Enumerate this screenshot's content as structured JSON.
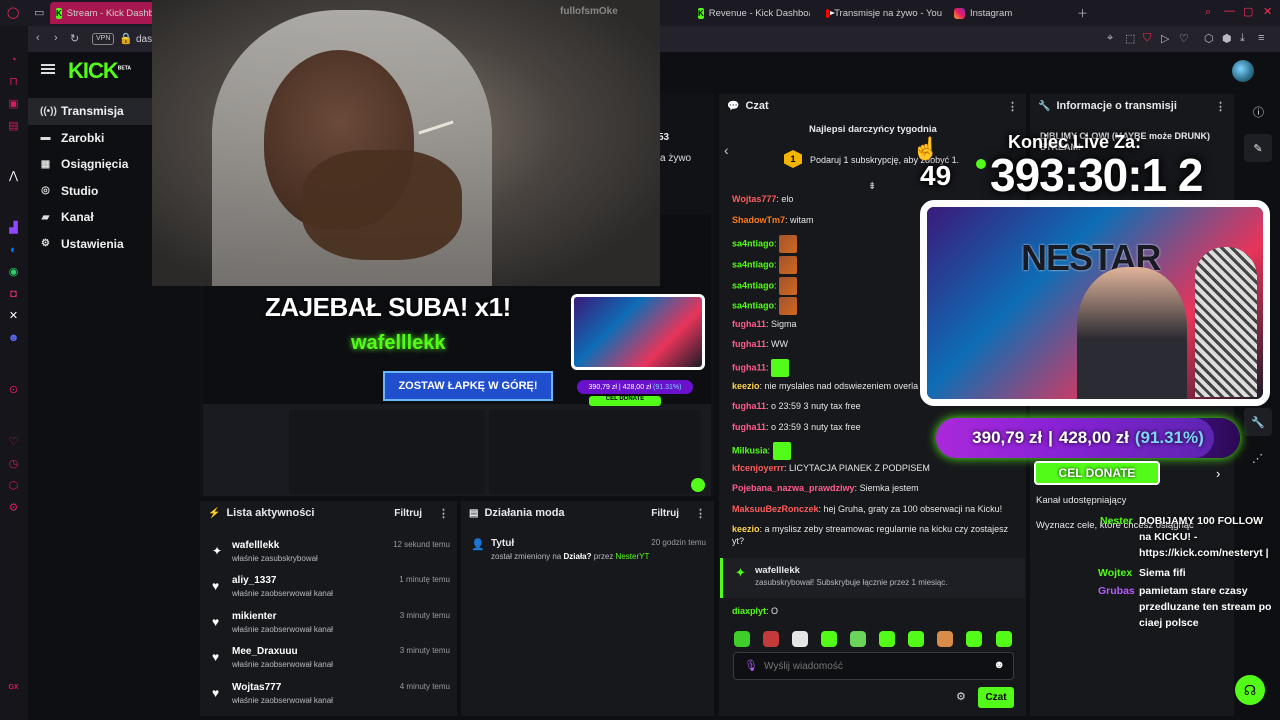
{
  "browser": {
    "tabs": [
      {
        "label": "Stream - Kick Dashbo",
        "icon": "kick-favicon",
        "active": true
      },
      {
        "label": "Revenue - Kick Dashboa",
        "icon": "kick-favicon"
      },
      {
        "label": "Transmisje na żywo - You",
        "icon": "youtube-favicon"
      },
      {
        "label": "Instagram",
        "icon": "instagram-favicon"
      }
    ],
    "address": "dash",
    "vpn_label": "VPN",
    "gx_label": "GX"
  },
  "app": {
    "logo": "KICK",
    "logo_badge": "BETA",
    "nav": [
      {
        "label": "Transmisja",
        "icon": "broadcast-icon",
        "active": true
      },
      {
        "label": "Zarobki",
        "icon": "wallet-icon"
      },
      {
        "label": "Osiągnięcia",
        "icon": "trophy-icon"
      },
      {
        "label": "Studio",
        "icon": "studio-icon"
      },
      {
        "label": "Kanał",
        "icon": "channel-icon"
      },
      {
        "label": "Ustawienia",
        "icon": "gear-icon"
      }
    ]
  },
  "middle": {
    "stream_title_partial": "53",
    "status_partial": "a żywo"
  },
  "activity": {
    "title": "Lista aktywności",
    "filter": "Filtruj",
    "items": [
      {
        "name": "wafelllekk",
        "sub": "właśnie zasubskrybował",
        "time": "12 sekund temu",
        "icon": "sparkle-icon"
      },
      {
        "name": "aliy_1337",
        "sub": "właśnie zaobserwował kanał",
        "time": "1 minutę temu",
        "icon": "heart-icon"
      },
      {
        "name": "mikienter",
        "sub": "właśnie zaobserwował kanał",
        "time": "3 minuty temu",
        "icon": "heart-icon"
      },
      {
        "name": "Mee_Draxuuu",
        "sub": "właśnie zaobserwował kanał",
        "time": "3 minuty temu",
        "icon": "heart-icon"
      },
      {
        "name": "Wojtas777",
        "sub": "właśnie zaobserwował kanał",
        "time": "4 minuty temu",
        "icon": "heart-icon"
      }
    ]
  },
  "modactions": {
    "title": "Działania moda",
    "filter": "Filtruj",
    "item": {
      "name": "Tytuł",
      "time": "20 godzin temu",
      "text": "został zmieniony na",
      "new_title": "Działa?",
      "by": "przez",
      "user": "NesterYT"
    }
  },
  "chat": {
    "title": "Czat",
    "top_gifters": "Najlepsi darczyńcy tygodnia",
    "gift_prompt": "Podaruj 1 subskrypcję, aby zdobyć 1.",
    "gift_rank": "1",
    "messages": [
      {
        "user": "Wojtas777",
        "color": "#ff5c5c",
        "text": "elo"
      },
      {
        "user": "ShadowTm7",
        "color": "#ff7a1a",
        "text": "witam"
      },
      {
        "user": "sa4ntiago",
        "color": "#53fc18",
        "text": "",
        "emote": true
      },
      {
        "user": "sa4ntiago",
        "color": "#53fc18",
        "text": "",
        "emote": true
      },
      {
        "user": "sa4ntiago",
        "color": "#53fc18",
        "text": "",
        "emote": true
      },
      {
        "user": "sa4ntiago",
        "color": "#53fc18",
        "text": "",
        "emote": true
      },
      {
        "user": "fugha11",
        "color": "#ff5c8a",
        "text": "Sigma"
      },
      {
        "user": "fugha11",
        "color": "#ff5c8a",
        "text": "WW"
      },
      {
        "user": "fugha11",
        "color": "#ff5c8a",
        "text": "",
        "emote": true
      },
      {
        "user": "keezio",
        "color": "#ffd24d",
        "text": "nie myslales nad odswiezeniem overla"
      },
      {
        "user": "fugha11",
        "color": "#ff5c8a",
        "text": "o 23:59 3 nuty tax free"
      },
      {
        "user": "fugha11",
        "color": "#ff5c8a",
        "text": "o 23:59 3 nuty tax free"
      },
      {
        "user": "Milkusia",
        "color": "#53fc18",
        "text": "",
        "emote": true
      },
      {
        "user": "kfcenjoyerrr",
        "color": "#ff5c5c",
        "text": "LICYTACJA PIANEK Z PODPISEM"
      },
      {
        "user": "Pojebana_nazwa_prawdziwy",
        "color": "#ff5c8a",
        "text": "Siemka jestem"
      },
      {
        "user": "MaksuuBezRonczek",
        "color": "#ff5c5c",
        "text": "hej Gruha, graty za 100 obserwacji na Kicku!"
      },
      {
        "user": "keezio",
        "color": "#ffd24d",
        "text": "a myslisz zeby streamowac regularnie na kicku czy zostajesz yt?"
      }
    ],
    "sub_event": {
      "user": "wafelllekk",
      "text": "zasubskrybował! Subskrybuje łącznie przez 1 miesiąc."
    },
    "last": {
      "user": "diaxplyt",
      "color": "#53fc18",
      "text": "O"
    },
    "input_placeholder": "Wyślij wiadomość",
    "send_label": "Czat"
  },
  "info_panel": {
    "title": "Informacje o transmisji",
    "partial_title": "DIBLIMY CLOWI (MAYBE może DRUNK) STREAM!",
    "cel_donate": "CEL DONATE",
    "shared_channel": "Kanał udostępniający",
    "goal_hint": "Wyznacz cele, które chcesz osiągnąć"
  },
  "overlay": {
    "meme_watermark": "fullofsmOke",
    "timer_label": "Koniec Live Za:",
    "timer": "393:30:1 2",
    "goal_amount": "390,79 zł",
    "goal_target": "428,00 zł",
    "goal_pct": "(91.31%)",
    "goal_pct_value": 91.31,
    "gift_counter": "49",
    "webcam_banner": "NESTAR",
    "chat_overlay": [
      {
        "user": "Nester",
        "color": "#53fc18",
        "text": "DOBIJAMY 100 FOLLOW na KICKU! - https://kick.com/nesteryt |"
      },
      {
        "user": "Wojtex",
        "color": "#53fc18",
        "text": "Siema fifi"
      },
      {
        "user": "Grubas",
        "color": "#b55cff",
        "text": "pamietam stare czasy przedluzane ten stream po ciaej polsce"
      }
    ],
    "preview_title": "ZAJEBAŁ SUBA! x1!",
    "preview_user": "wafelllekk",
    "preview_cta": "ZOSTAW ŁAPKĘ W GÓRĘ!"
  }
}
